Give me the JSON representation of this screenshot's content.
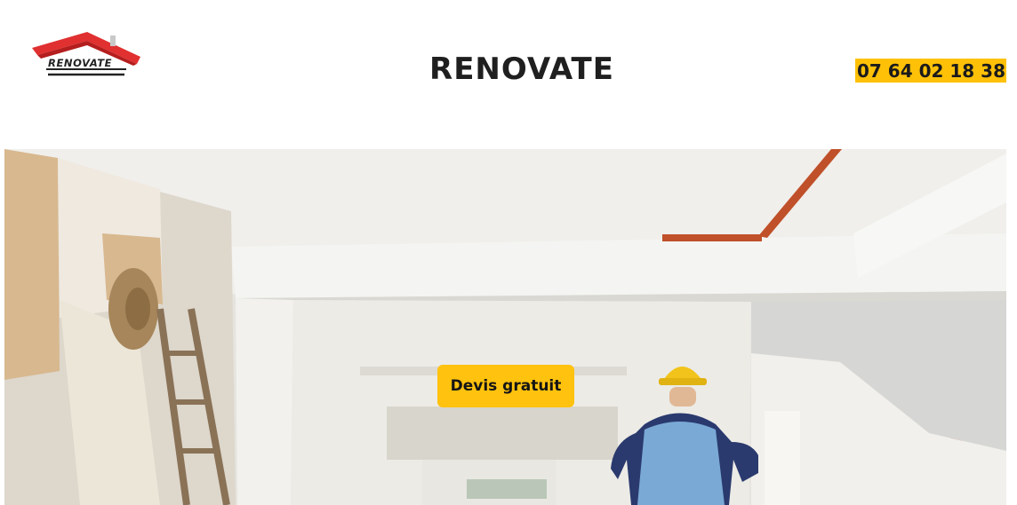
{
  "header": {
    "logo_text": "RENOVATE",
    "title": "RENOVATE",
    "phone": "07 64 02 18 38"
  },
  "hero": {
    "image_icon": "renovation-worker-image",
    "cta_label": "Devis gratuit"
  },
  "colors": {
    "accent": "#ffc107",
    "logo_roof": "#e02a2a",
    "text": "#1f1f1f"
  }
}
